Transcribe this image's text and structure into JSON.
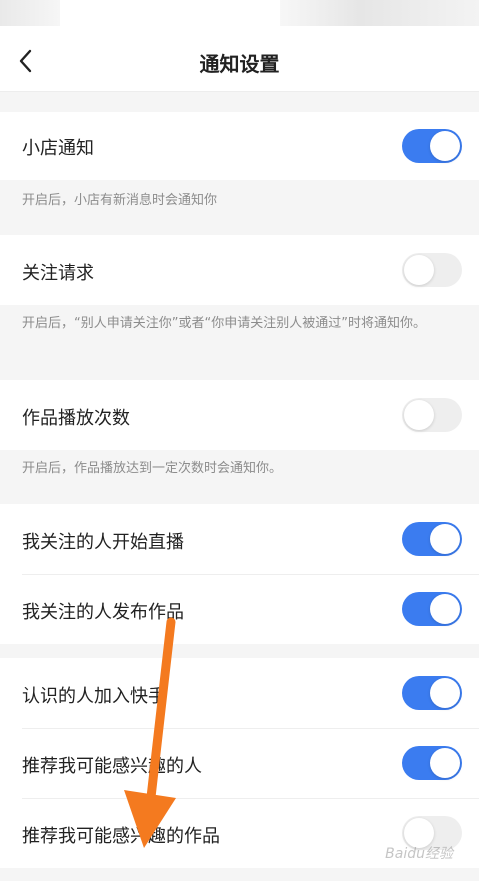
{
  "header": {
    "title": "通知设置"
  },
  "items": [
    {
      "label": "小店通知",
      "on": true,
      "desc": "开启后，小店有新消息时会通知你"
    },
    {
      "label": "关注请求",
      "on": false,
      "desc": "开启后，“别人申请关注你”或者“你申请关注别人被通过”时将通知你。"
    },
    {
      "label": "作品播放次数",
      "on": false,
      "desc": "开启后，作品播放达到一定次数时会通知你。"
    },
    {
      "label": "我关注的人开始直播",
      "on": true
    },
    {
      "label": "我关注的人发布作品",
      "on": true
    },
    {
      "label": "认识的人加入快手",
      "on": true
    },
    {
      "label": "推荐我可能感兴趣的人",
      "on": true
    },
    {
      "label": "推荐我可能感兴趣的作品",
      "on": false
    }
  ],
  "watermark": "Baidu经验",
  "colors": {
    "toggle_on": "#3b7cf0",
    "toggle_off": "#eeeeee",
    "arrow": "#f47a1f"
  }
}
